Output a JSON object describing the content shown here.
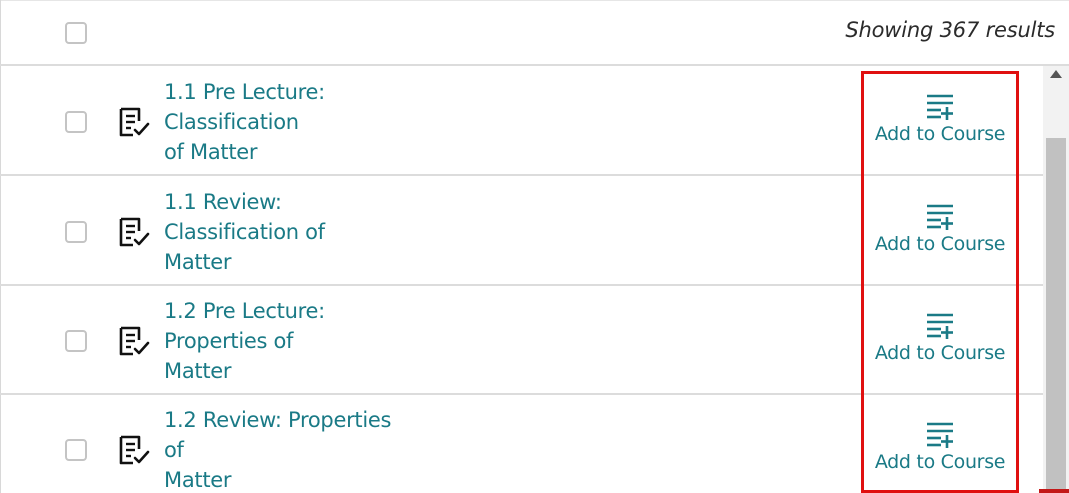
{
  "header": {
    "results_text": "Showing 367 results"
  },
  "items": [
    {
      "title_lines": [
        "1.1 Pre Lecture:",
        "Classification",
        "of Matter"
      ],
      "action_label": "Add to Course"
    },
    {
      "title_lines": [
        "1.1 Review:",
        "Classification of",
        "Matter"
      ],
      "action_label": "Add to Course"
    },
    {
      "title_lines": [
        "1.2 Pre Lecture:",
        "Properties of",
        "Matter"
      ],
      "action_label": "Add to Course"
    },
    {
      "title_lines": [
        "1.2 Review: Properties",
        "of",
        "Matter"
      ],
      "action_label": "Add to Course"
    }
  ],
  "icons": {
    "item_icon": "assignment-check-icon",
    "action_icon": "playlist-add-icon"
  },
  "colors": {
    "link": "#1a7a86",
    "highlight": "#e01010"
  }
}
